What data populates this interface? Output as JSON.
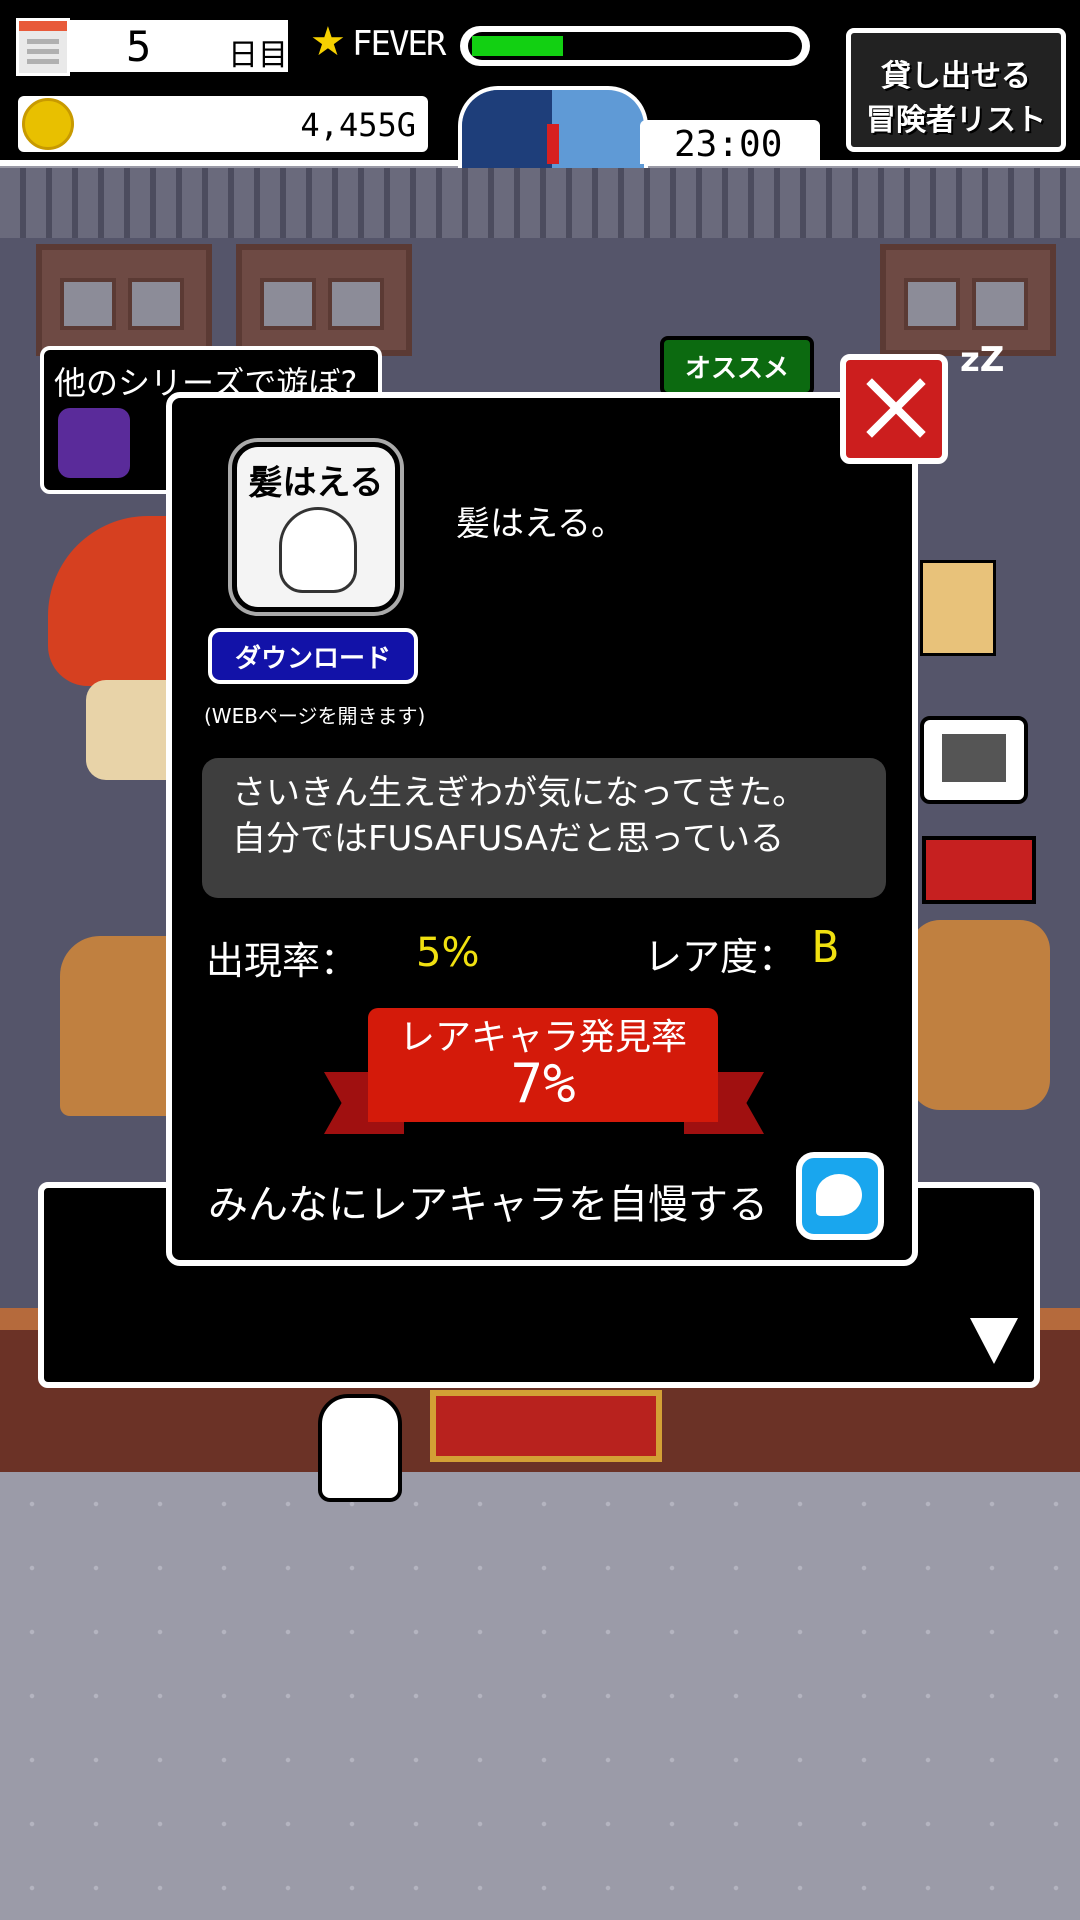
{
  "hud": {
    "day_number": "5",
    "day_unit": "日目",
    "fever_label": "FEVER",
    "fever_level": 0.28,
    "gold": "4,455G",
    "time": "23:00",
    "rental_button_line1": "貸し出せる",
    "rental_button_line2": "冒険者リスト"
  },
  "scene": {
    "other_series_label": "他のシリーズで遊ぼ?",
    "recommend_label": "オススメ",
    "sleep_text": "zZ"
  },
  "dialog": {
    "app_icon_title": "髪はえる",
    "app_name": "髪はえる。",
    "download_label": "ダウンロード",
    "web_note": "(WEBページを開きます)",
    "description": "さいきん生えぎわが気になってきた。\n自分ではFUSAFUSAだと思っている",
    "appearance_label": "出現率：",
    "appearance_value": "5%",
    "rarity_label": "レア度：",
    "rarity_value": "B",
    "rare_find_label": "レアキャラ発見率",
    "rare_find_value": "7%",
    "share_label": "みんなにレアキャラを自慢する"
  },
  "colors": {
    "accent_yellow": "#f0e010",
    "ribbon_red": "#d41a0a",
    "close_red": "#cc1e1e",
    "download_blue": "#1212a8",
    "share_blue": "#19a6ee",
    "fever_green": "#12d012"
  },
  "icons": [
    "calendar-menu-icon",
    "star-icon",
    "gold-coin-icon",
    "clock-dial-icon",
    "close-icon",
    "share-bird-icon",
    "next-arrow-icon"
  ]
}
